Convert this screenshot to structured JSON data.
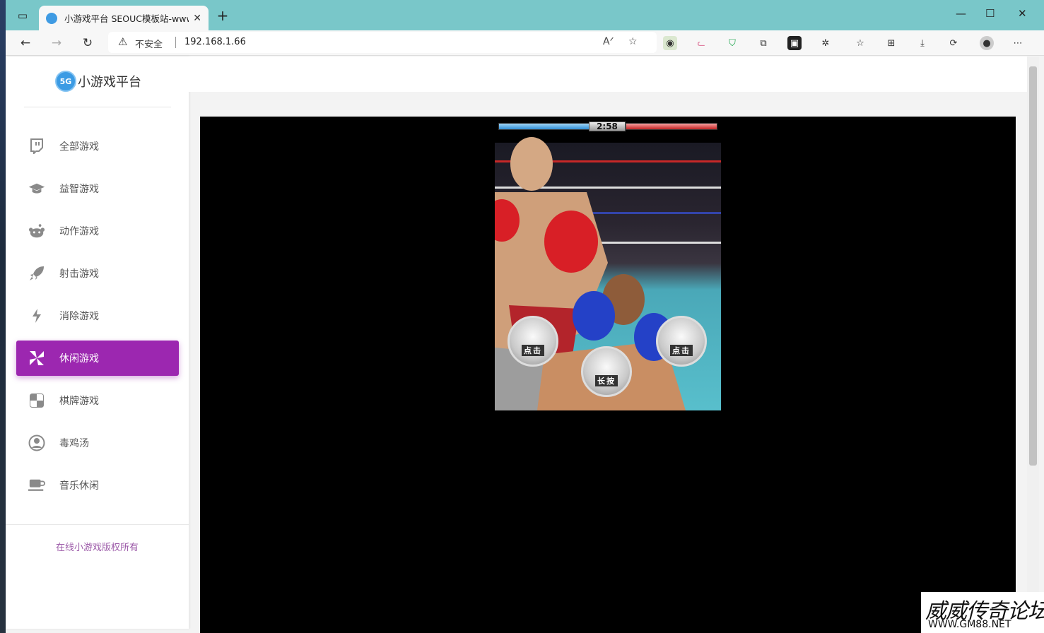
{
  "browser": {
    "tab_title": "小游戏平台 SEOUC模板站-www.s",
    "url": "192.168.1.66",
    "security_label": "不安全"
  },
  "site": {
    "logo_badge": "5G",
    "logo_text": "小游戏平台",
    "footer": "在线小游戏版权所有"
  },
  "sidebar": {
    "items": [
      {
        "label": "全部游戏",
        "icon": "twitch-icon"
      },
      {
        "label": "益智游戏",
        "icon": "graduation-cap-icon"
      },
      {
        "label": "动作游戏",
        "icon": "reddit-icon"
      },
      {
        "label": "射击游戏",
        "icon": "rocket-icon"
      },
      {
        "label": "消除游戏",
        "icon": "bolt-icon"
      },
      {
        "label": "休闲游戏",
        "icon": "pinwheel-icon",
        "active": true
      },
      {
        "label": "棋牌游戏",
        "icon": "checker-icon"
      },
      {
        "label": "毒鸡汤",
        "icon": "user-circle-icon"
      },
      {
        "label": "音乐休闲",
        "icon": "coffee-icon"
      }
    ]
  },
  "game": {
    "timer": "2:58",
    "left_button": "点击",
    "right_button": "点击",
    "center_button": "长按"
  },
  "watermark": {
    "line1": "威威传奇论坛",
    "line2": "WWW.GM88.NET"
  },
  "colors": {
    "accent": "#9c27b0",
    "tabbar": "#79c7c9"
  }
}
